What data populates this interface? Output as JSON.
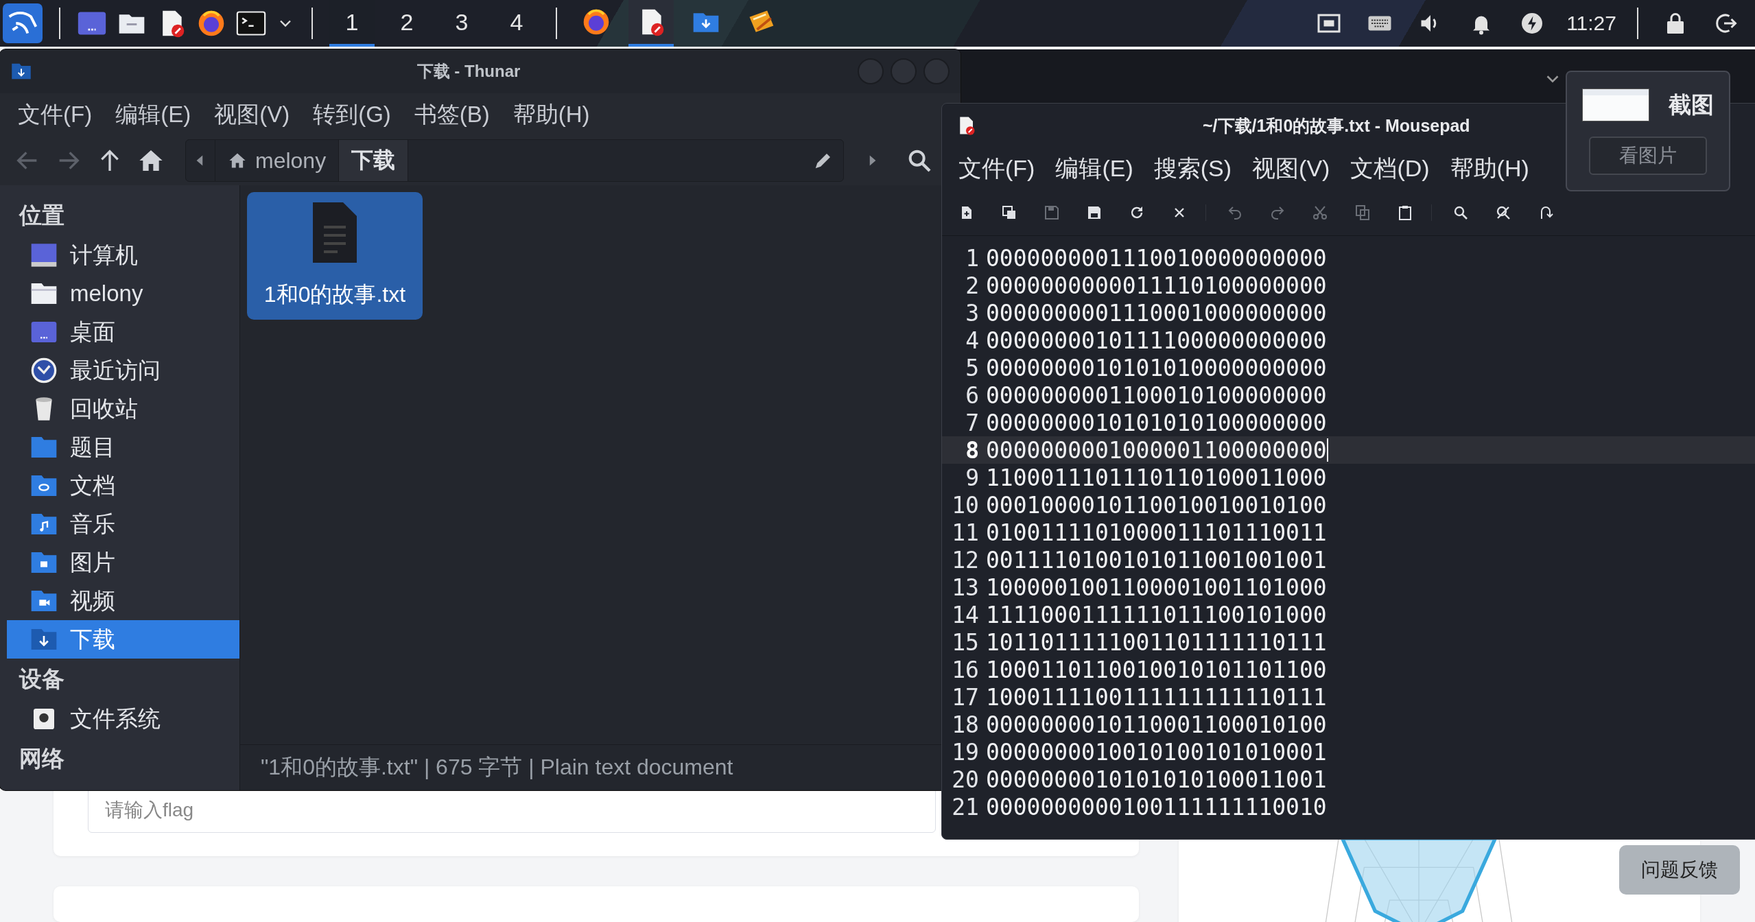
{
  "taskbar": {
    "launchers": [
      {
        "kind": "menu"
      },
      {
        "kind": "desktop"
      },
      {
        "kind": "files"
      },
      {
        "kind": "editor"
      },
      {
        "kind": "browser"
      },
      {
        "kind": "terminal"
      },
      {
        "kind": "more"
      }
    ],
    "workspaces": [
      {
        "label": "1",
        "selected": true
      },
      {
        "label": "2",
        "selected": false
      },
      {
        "label": "3",
        "selected": false
      },
      {
        "label": "4",
        "selected": false
      }
    ],
    "tasks": [
      {
        "kind": "browser",
        "selected": false
      },
      {
        "kind": "editor",
        "selected": true
      },
      {
        "kind": "download-folder",
        "selected": false
      },
      {
        "kind": "notes",
        "selected": false
      }
    ],
    "tray": [
      {
        "kind": "network"
      },
      {
        "kind": "keyboard"
      },
      {
        "kind": "volume"
      },
      {
        "kind": "bell"
      },
      {
        "kind": "power"
      }
    ],
    "clock": "11:27",
    "session": [
      {
        "kind": "lock"
      },
      {
        "kind": "logout"
      }
    ]
  },
  "web_page": {
    "flag_input": {
      "placeholder": "请输入flag"
    },
    "feedback_button": "问题反馈"
  },
  "file_manager": {
    "title": "下载 - Thunar",
    "menu": [
      "文件(F)",
      "编辑(E)",
      "视图(V)",
      "转到(G)",
      "书签(B)",
      "帮助(H)"
    ],
    "nav": [
      {
        "kind": "back",
        "disabled": true
      },
      {
        "kind": "forward",
        "disabled": true
      },
      {
        "kind": "up",
        "disabled": false
      },
      {
        "kind": "home",
        "disabled": false
      }
    ],
    "path": [
      {
        "label": "melony",
        "kind": "home",
        "selected": false
      },
      {
        "label": "下载",
        "kind": "folder",
        "selected": true
      }
    ],
    "sidebar": [
      {
        "heading": "位置",
        "items": [
          {
            "label": "计算机",
            "kind": "computer",
            "selected": false
          },
          {
            "label": "melony",
            "kind": "home",
            "selected": false
          },
          {
            "label": "桌面",
            "kind": "desktop",
            "selected": false
          },
          {
            "label": "最近访问",
            "kind": "recent",
            "selected": false
          },
          {
            "label": "回收站",
            "kind": "trash",
            "selected": false
          },
          {
            "label": "题目",
            "kind": "folder",
            "selected": false
          },
          {
            "label": "文档",
            "kind": "documents",
            "selected": false
          },
          {
            "label": "音乐",
            "kind": "music",
            "selected": false
          },
          {
            "label": "图片",
            "kind": "pictures",
            "selected": false
          },
          {
            "label": "视频",
            "kind": "videos",
            "selected": false
          },
          {
            "label": "下载",
            "kind": "download",
            "selected": true
          }
        ]
      },
      {
        "heading": "设备",
        "items": [
          {
            "label": "文件系统",
            "kind": "drive",
            "selected": false
          }
        ]
      },
      {
        "heading": "网络"
      }
    ],
    "files": [
      {
        "name": "1和0的故事.txt",
        "selected": true
      }
    ],
    "status": "\"1和0的故事.txt\" | 675 字节 | Plain text document"
  },
  "editor": {
    "title": "~/下载/1和0的故事.txt - Mousepad",
    "menu": [
      "文件(F)",
      "编辑(E)",
      "搜索(S)",
      "视图(V)",
      "文档(D)",
      "帮助(H)"
    ],
    "toolbar": [
      [
        {
          "kind": "new",
          "disabled": false
        },
        {
          "kind": "new-window",
          "disabled": false
        },
        {
          "kind": "save",
          "disabled": true
        },
        {
          "kind": "save-as",
          "disabled": false
        },
        {
          "kind": "reload",
          "disabled": false
        },
        {
          "kind": "close",
          "disabled": false
        }
      ],
      [
        {
          "kind": "undo",
          "disabled": true
        },
        {
          "kind": "redo",
          "disabled": true
        },
        {
          "kind": "cut",
          "disabled": true
        },
        {
          "kind": "copy",
          "disabled": true
        },
        {
          "kind": "paste",
          "disabled": false
        }
      ],
      [
        {
          "kind": "find",
          "disabled": false
        },
        {
          "kind": "replace",
          "disabled": false
        },
        {
          "kind": "goto",
          "disabled": false
        }
      ]
    ],
    "lines": [
      {
        "number": "1",
        "text": "0000000001110010000000000",
        "current": false
      },
      {
        "number": "2",
        "text": "0000000000011110100000000",
        "current": false
      },
      {
        "number": "3",
        "text": "0000000001110001000000000",
        "current": false
      },
      {
        "number": "4",
        "text": "0000000010111100000000000",
        "current": false
      },
      {
        "number": "5",
        "text": "0000000010101010000000000",
        "current": false
      },
      {
        "number": "6",
        "text": "0000000001100010100000000",
        "current": false
      },
      {
        "number": "7",
        "text": "0000000010101010100000000",
        "current": false
      },
      {
        "number": "8",
        "text": "0000000001000001100000000",
        "current": true
      },
      {
        "number": "9",
        "text": "1100011101110110100011000",
        "current": false
      },
      {
        "number": "10",
        "text": "0001000010110010010010100",
        "current": false
      },
      {
        "number": "11",
        "text": "0100111101000011101110011",
        "current": false
      },
      {
        "number": "12",
        "text": "0011110100101011001001001",
        "current": false
      },
      {
        "number": "13",
        "text": "1000001001100001001101000",
        "current": false
      },
      {
        "number": "14",
        "text": "1111000111111011100101000",
        "current": false
      },
      {
        "number": "15",
        "text": "1011011111001101111110111",
        "current": false
      },
      {
        "number": "16",
        "text": "1000110110010010101101100",
        "current": false
      },
      {
        "number": "17",
        "text": "1000111100111111111110111",
        "current": false
      },
      {
        "number": "18",
        "text": "0000000010110001100010100",
        "current": false
      },
      {
        "number": "19",
        "text": "0000000010010100101010001",
        "current": false
      },
      {
        "number": "20",
        "text": "0000000010101010100011001",
        "current": false
      },
      {
        "number": "21",
        "text": "0000000000100111111110010",
        "current": false
      }
    ]
  },
  "screenshot_popup": {
    "title": "截图",
    "button": "看图片"
  }
}
